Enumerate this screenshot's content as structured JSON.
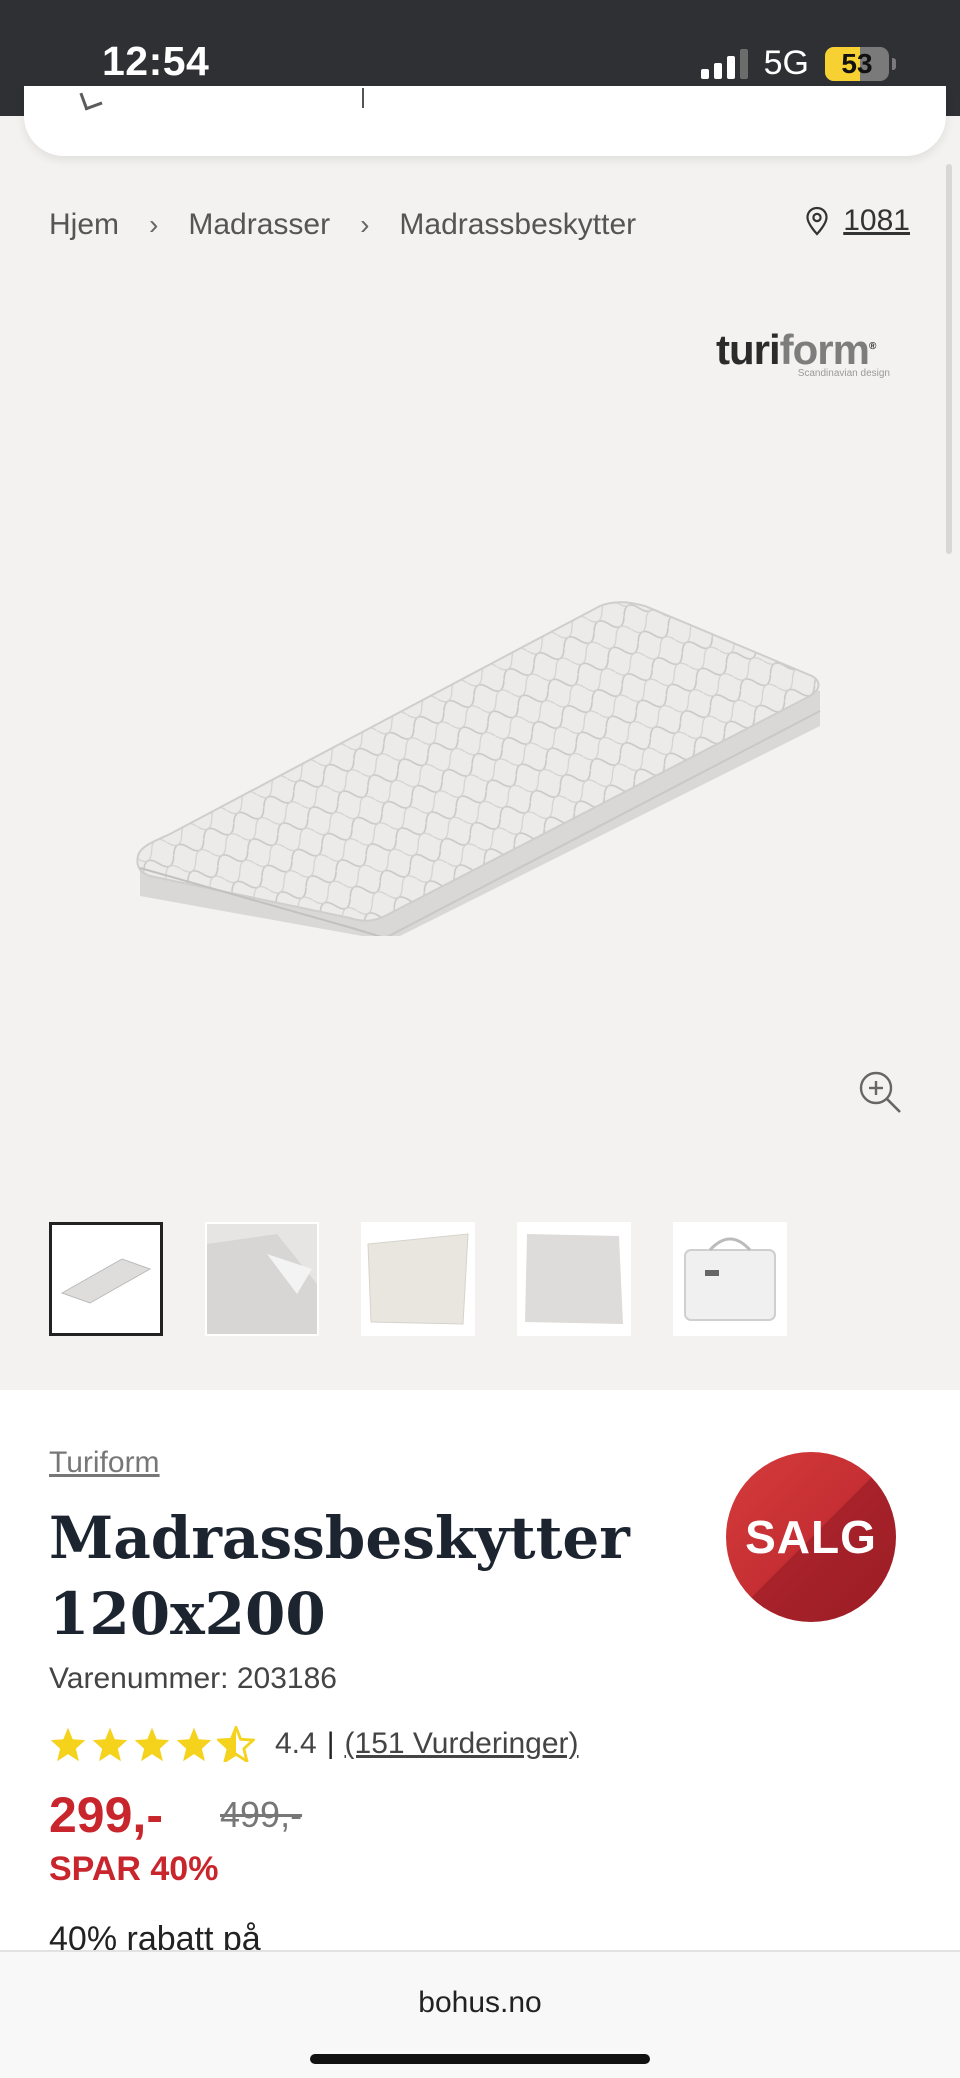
{
  "status_bar": {
    "time": "12:54",
    "network": "5G",
    "battery": "53"
  },
  "breadcrumb": {
    "items": [
      "Hjem",
      "Madrasser",
      "Madrassbeskytter"
    ],
    "separator": "›"
  },
  "store": {
    "number": "1081"
  },
  "brand_logo": {
    "main": "turi",
    "lite": "form",
    "tagline": "Scandinavian design"
  },
  "gallery": {
    "thumbnail_count": 5,
    "active_index": 0
  },
  "product": {
    "brand": "Turiform",
    "title_line1": "Madrassbeskytter",
    "title_line2": "120x200",
    "sku": "Varenummer: 203186",
    "badge": "SALG",
    "rating_value": "4.4",
    "rating_separator": "|",
    "rating_count": "(151 Vurderinger)",
    "rating_stars": 4.5,
    "price": "299,-",
    "old_price": "499,-",
    "save": "SPAR 40%",
    "promo": "40% rabatt på"
  },
  "browser": {
    "domain": "bohus.no"
  },
  "colors": {
    "sale_red": "#c8262c",
    "star_yellow": "#f5d21c",
    "gallery_bg": "#f3f2f0"
  }
}
